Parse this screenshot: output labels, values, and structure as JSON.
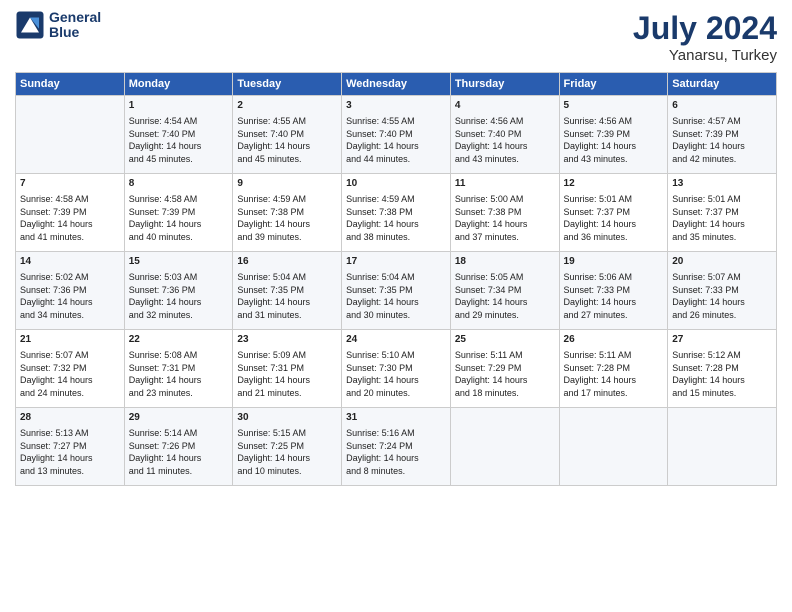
{
  "logo": {
    "line1": "General",
    "line2": "Blue"
  },
  "title": {
    "month_year": "July 2024",
    "location": "Yanarsu, Turkey"
  },
  "days_of_week": [
    "Sunday",
    "Monday",
    "Tuesday",
    "Wednesday",
    "Thursday",
    "Friday",
    "Saturday"
  ],
  "weeks": [
    [
      {
        "day": "",
        "content": ""
      },
      {
        "day": "1",
        "content": "Sunrise: 4:54 AM\nSunset: 7:40 PM\nDaylight: 14 hours\nand 45 minutes."
      },
      {
        "day": "2",
        "content": "Sunrise: 4:55 AM\nSunset: 7:40 PM\nDaylight: 14 hours\nand 45 minutes."
      },
      {
        "day": "3",
        "content": "Sunrise: 4:55 AM\nSunset: 7:40 PM\nDaylight: 14 hours\nand 44 minutes."
      },
      {
        "day": "4",
        "content": "Sunrise: 4:56 AM\nSunset: 7:40 PM\nDaylight: 14 hours\nand 43 minutes."
      },
      {
        "day": "5",
        "content": "Sunrise: 4:56 AM\nSunset: 7:39 PM\nDaylight: 14 hours\nand 43 minutes."
      },
      {
        "day": "6",
        "content": "Sunrise: 4:57 AM\nSunset: 7:39 PM\nDaylight: 14 hours\nand 42 minutes."
      }
    ],
    [
      {
        "day": "7",
        "content": "Sunrise: 4:58 AM\nSunset: 7:39 PM\nDaylight: 14 hours\nand 41 minutes."
      },
      {
        "day": "8",
        "content": "Sunrise: 4:58 AM\nSunset: 7:39 PM\nDaylight: 14 hours\nand 40 minutes."
      },
      {
        "day": "9",
        "content": "Sunrise: 4:59 AM\nSunset: 7:38 PM\nDaylight: 14 hours\nand 39 minutes."
      },
      {
        "day": "10",
        "content": "Sunrise: 4:59 AM\nSunset: 7:38 PM\nDaylight: 14 hours\nand 38 minutes."
      },
      {
        "day": "11",
        "content": "Sunrise: 5:00 AM\nSunset: 7:38 PM\nDaylight: 14 hours\nand 37 minutes."
      },
      {
        "day": "12",
        "content": "Sunrise: 5:01 AM\nSunset: 7:37 PM\nDaylight: 14 hours\nand 36 minutes."
      },
      {
        "day": "13",
        "content": "Sunrise: 5:01 AM\nSunset: 7:37 PM\nDaylight: 14 hours\nand 35 minutes."
      }
    ],
    [
      {
        "day": "14",
        "content": "Sunrise: 5:02 AM\nSunset: 7:36 PM\nDaylight: 14 hours\nand 34 minutes."
      },
      {
        "day": "15",
        "content": "Sunrise: 5:03 AM\nSunset: 7:36 PM\nDaylight: 14 hours\nand 32 minutes."
      },
      {
        "day": "16",
        "content": "Sunrise: 5:04 AM\nSunset: 7:35 PM\nDaylight: 14 hours\nand 31 minutes."
      },
      {
        "day": "17",
        "content": "Sunrise: 5:04 AM\nSunset: 7:35 PM\nDaylight: 14 hours\nand 30 minutes."
      },
      {
        "day": "18",
        "content": "Sunrise: 5:05 AM\nSunset: 7:34 PM\nDaylight: 14 hours\nand 29 minutes."
      },
      {
        "day": "19",
        "content": "Sunrise: 5:06 AM\nSunset: 7:33 PM\nDaylight: 14 hours\nand 27 minutes."
      },
      {
        "day": "20",
        "content": "Sunrise: 5:07 AM\nSunset: 7:33 PM\nDaylight: 14 hours\nand 26 minutes."
      }
    ],
    [
      {
        "day": "21",
        "content": "Sunrise: 5:07 AM\nSunset: 7:32 PM\nDaylight: 14 hours\nand 24 minutes."
      },
      {
        "day": "22",
        "content": "Sunrise: 5:08 AM\nSunset: 7:31 PM\nDaylight: 14 hours\nand 23 minutes."
      },
      {
        "day": "23",
        "content": "Sunrise: 5:09 AM\nSunset: 7:31 PM\nDaylight: 14 hours\nand 21 minutes."
      },
      {
        "day": "24",
        "content": "Sunrise: 5:10 AM\nSunset: 7:30 PM\nDaylight: 14 hours\nand 20 minutes."
      },
      {
        "day": "25",
        "content": "Sunrise: 5:11 AM\nSunset: 7:29 PM\nDaylight: 14 hours\nand 18 minutes."
      },
      {
        "day": "26",
        "content": "Sunrise: 5:11 AM\nSunset: 7:28 PM\nDaylight: 14 hours\nand 17 minutes."
      },
      {
        "day": "27",
        "content": "Sunrise: 5:12 AM\nSunset: 7:28 PM\nDaylight: 14 hours\nand 15 minutes."
      }
    ],
    [
      {
        "day": "28",
        "content": "Sunrise: 5:13 AM\nSunset: 7:27 PM\nDaylight: 14 hours\nand 13 minutes."
      },
      {
        "day": "29",
        "content": "Sunrise: 5:14 AM\nSunset: 7:26 PM\nDaylight: 14 hours\nand 11 minutes."
      },
      {
        "day": "30",
        "content": "Sunrise: 5:15 AM\nSunset: 7:25 PM\nDaylight: 14 hours\nand 10 minutes."
      },
      {
        "day": "31",
        "content": "Sunrise: 5:16 AM\nSunset: 7:24 PM\nDaylight: 14 hours\nand 8 minutes."
      },
      {
        "day": "",
        "content": ""
      },
      {
        "day": "",
        "content": ""
      },
      {
        "day": "",
        "content": ""
      }
    ]
  ]
}
